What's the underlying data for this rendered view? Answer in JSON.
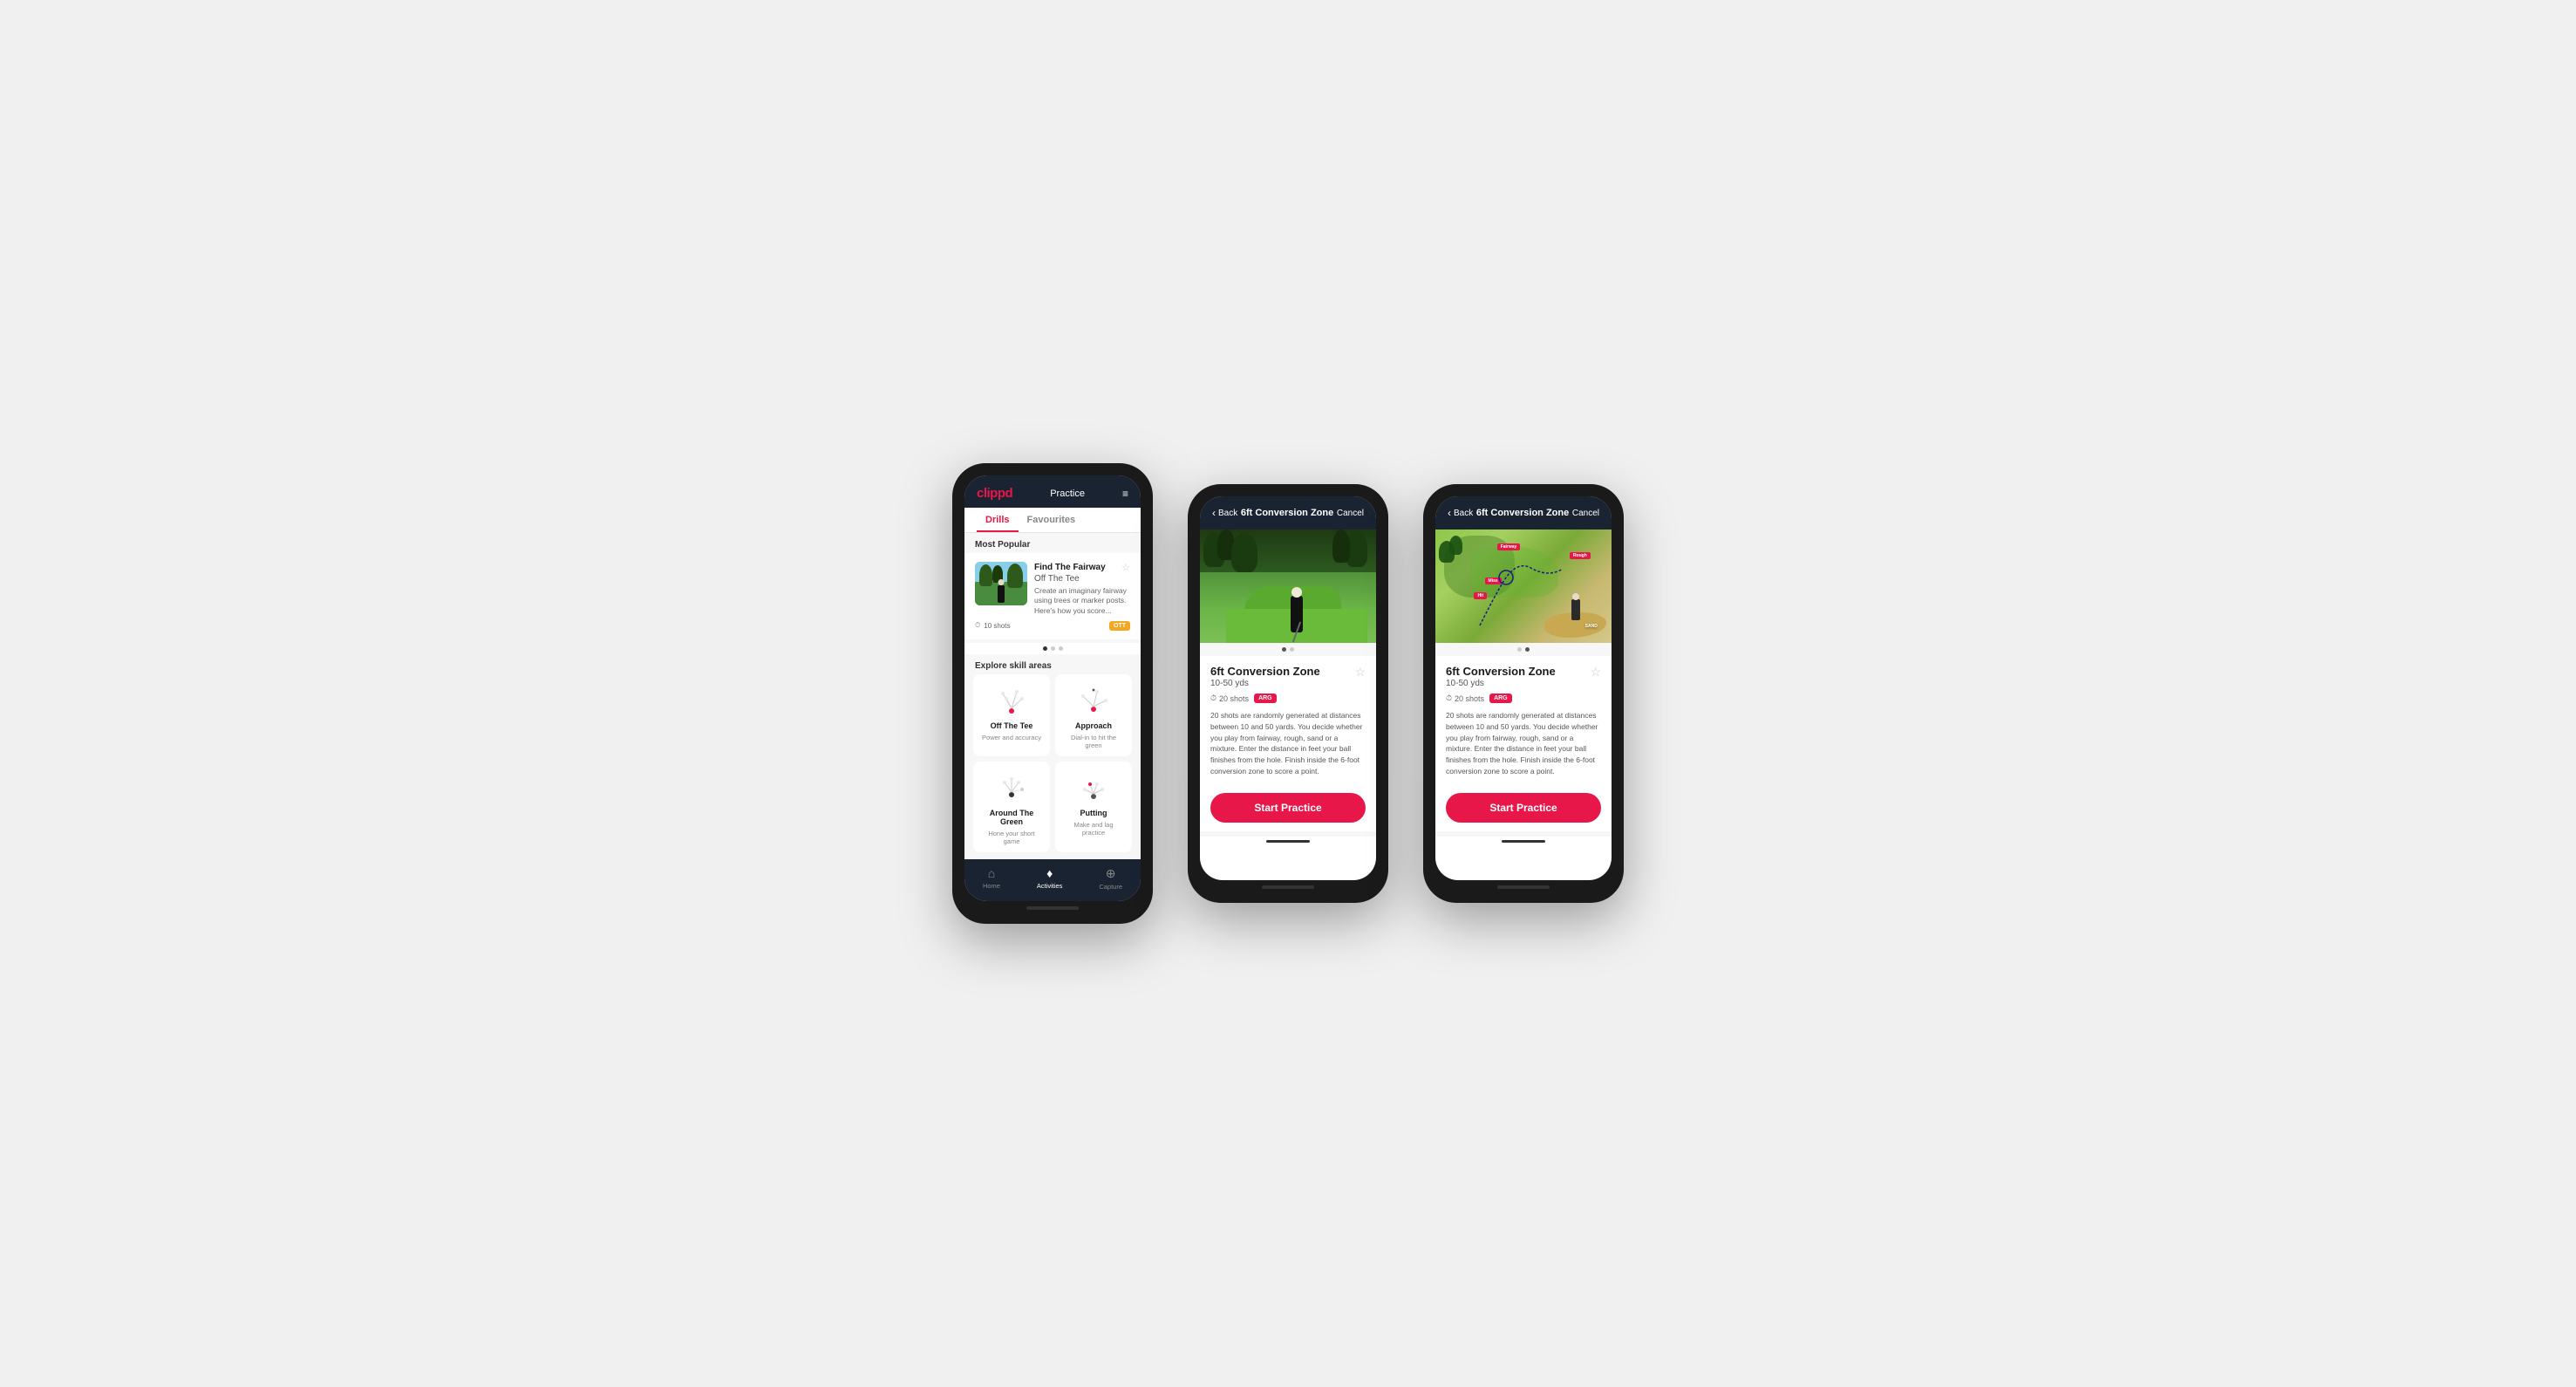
{
  "app": {
    "logo": "clippd",
    "nav_label": "Practice",
    "menu_icon": "≡"
  },
  "phone1": {
    "tabs": [
      {
        "label": "Drills",
        "active": true
      },
      {
        "label": "Favourites",
        "active": false
      }
    ],
    "most_popular_label": "Most Popular",
    "featured_drill": {
      "title": "Find The Fairway",
      "subtitle": "Off The Tee",
      "description": "Create an imaginary fairway using trees or marker posts. Here's how you score...",
      "shots": "10 shots",
      "badge": "OTT"
    },
    "explore_label": "Explore skill areas",
    "skills": [
      {
        "name": "Off The Tee",
        "desc": "Power and accuracy"
      },
      {
        "name": "Approach",
        "desc": "Dial-in to hit the green"
      },
      {
        "name": "Around The Green",
        "desc": "Hone your short game"
      },
      {
        "name": "Putting",
        "desc": "Make and lag practice"
      }
    ],
    "nav": [
      {
        "icon": "⌂",
        "label": "Home",
        "active": false
      },
      {
        "icon": "♦",
        "label": "Activities",
        "active": true
      },
      {
        "icon": "⊕",
        "label": "Capture",
        "active": false
      }
    ]
  },
  "phone2": {
    "back_label": "Back",
    "title": "6ft Conversion Zone",
    "cancel_label": "Cancel",
    "drill_name": "6ft Conversion Zone",
    "drill_range": "10-50 yds",
    "shots": "20 shots",
    "badge": "ARG",
    "description": "20 shots are randomly generated at distances between 10 and 50 yards. You decide whether you play from fairway, rough, sand or a mixture. Enter the distance in feet your ball finishes from the hole. Finish inside the 6-foot conversion zone to score a point.",
    "start_btn": "Start Practice"
  },
  "phone3": {
    "back_label": "Back",
    "title": "6ft Conversion Zone",
    "cancel_label": "Cancel",
    "drill_name": "6ft Conversion Zone",
    "drill_range": "10-50 yds",
    "shots": "20 shots",
    "badge": "ARG",
    "description": "20 shots are randomly generated at distances between 10 and 50 yards. You decide whether you play from fairway, rough, sand or a mixture. Enter the distance in feet your ball finishes from the hole. Finish inside the 6-foot conversion zone to score a point.",
    "start_btn": "Start Practice",
    "map_labels": [
      "Fairway",
      "Rough",
      "Miss",
      "Hit",
      "Sand"
    ]
  }
}
